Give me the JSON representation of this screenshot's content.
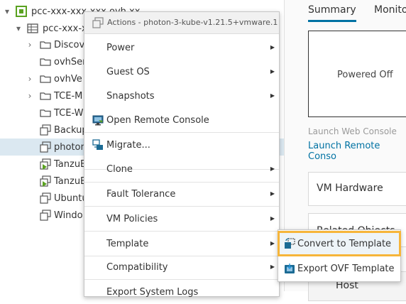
{
  "tree": {
    "items": [
      {
        "label": "pcc-xxx-xxx-xxx.ovh.xx",
        "icon": "datacenter-icon",
        "expander": "▾"
      },
      {
        "label": "pcc-xxx-x",
        "icon": "cluster-icon",
        "expander": "▾"
      },
      {
        "label": "Discov",
        "icon": "folder-icon",
        "expander": "›"
      },
      {
        "label": "ovhSer",
        "icon": "folder-icon",
        "expander": ""
      },
      {
        "label": "ovhVe",
        "icon": "folder-icon",
        "expander": "›"
      },
      {
        "label": "TCE-M",
        "icon": "folder-icon",
        "expander": "›"
      },
      {
        "label": "TCE-W",
        "icon": "folder-icon",
        "expander": ""
      },
      {
        "label": "Backup",
        "icon": "vm-icon",
        "expander": ""
      },
      {
        "label": "photon",
        "icon": "vm-icon",
        "expander": ""
      },
      {
        "label": "TanzuB",
        "icon": "vm-running-icon",
        "expander": ""
      },
      {
        "label": "TanzuE",
        "icon": "vm-running-icon",
        "expander": ""
      },
      {
        "label": "Ubuntu",
        "icon": "vm-icon",
        "expander": ""
      },
      {
        "label": "Windo",
        "icon": "vm-icon",
        "expander": ""
      }
    ]
  },
  "right": {
    "tabs": [
      "Summary",
      "Monito"
    ],
    "console_status": "Powered Off",
    "launch_web": "Launch Web Console",
    "launch_remote": "Launch Remote Conso",
    "card_vm_hardware": "VM Hardware",
    "card_related": "Related Objects",
    "card_host": "Host"
  },
  "menu": {
    "header": "Actions - photon-3-kube-v1.21.5+vmware.1",
    "items": [
      {
        "label": "Power",
        "submenu": true
      },
      {
        "label": "Guest OS",
        "submenu": true
      },
      {
        "label": "Snapshots",
        "submenu": true
      },
      {
        "label": "Open Remote Console",
        "submenu": false
      },
      {
        "label": "Migrate...",
        "submenu": false
      },
      {
        "label": "Clone",
        "submenu": true
      },
      {
        "label": "Fault Tolerance",
        "submenu": true
      },
      {
        "label": "VM Policies",
        "submenu": true
      },
      {
        "label": "Template",
        "submenu": true
      },
      {
        "label": "Compatibility",
        "submenu": true
      },
      {
        "label": "Export System Logs",
        "submenu": false
      }
    ],
    "arrow": "▶"
  },
  "submenu": {
    "items": [
      {
        "label": "Convert to Template"
      },
      {
        "label": "Export OVF Template"
      }
    ]
  },
  "colors": {
    "accent": "#0072a3",
    "highlight_outline": "#f6b53a",
    "vm_icon": "#1c6b94",
    "running_green": "#5aa220"
  }
}
